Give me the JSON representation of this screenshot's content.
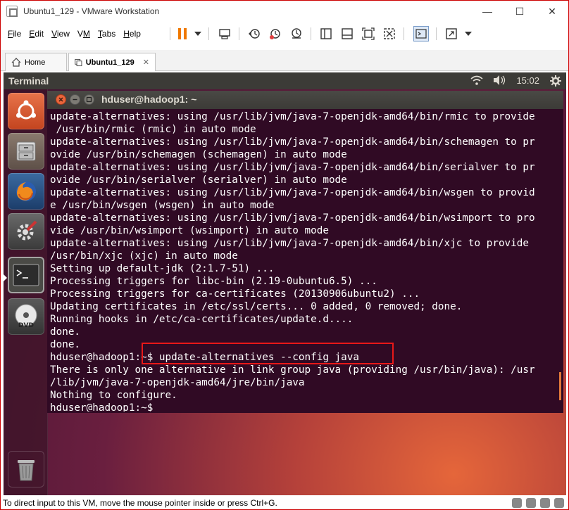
{
  "window": {
    "title": "Ubuntu1_129 - VMware Workstation",
    "controls": {
      "minimize": "—",
      "maximize": "☐",
      "close": "✕"
    }
  },
  "menu": {
    "items": [
      {
        "label": "File",
        "accel": "F"
      },
      {
        "label": "Edit",
        "accel": "E"
      },
      {
        "label": "View",
        "accel": "V"
      },
      {
        "label": "VM",
        "accel": "M"
      },
      {
        "label": "Tabs",
        "accel": "T"
      },
      {
        "label": "Help",
        "accel": "H"
      }
    ]
  },
  "toolbar": {
    "icons": [
      "pause-icon",
      "dropdown-icon",
      "send-ctrl-alt-del-icon",
      "snapshot-icon",
      "revert-snapshot-icon",
      "snapshot-manager-icon",
      "sidebar-icon",
      "thumbnail-icon",
      "fullscreen-icon",
      "unity-icon",
      "console-icon",
      "stretch-icon"
    ]
  },
  "tabs": [
    {
      "label": "Home",
      "icon": "home-icon"
    },
    {
      "label": "Ubuntu1_129",
      "icon": "vm-icon",
      "active": true
    }
  ],
  "guest_panel": {
    "app_name": "Terminal",
    "time": "15:02",
    "icons": [
      "wifi-icon",
      "volume-icon",
      "settings-icon"
    ]
  },
  "launcher": {
    "items": [
      {
        "name": "ubuntu-dash-icon"
      },
      {
        "name": "files-icon"
      },
      {
        "name": "firefox-icon"
      },
      {
        "name": "system-settings-icon"
      },
      {
        "name": "terminal-icon",
        "active": true
      },
      {
        "name": "dvd-icon"
      }
    ],
    "trash": "trash-icon"
  },
  "terminal": {
    "title": "hduser@hadoop1: ~",
    "lines": [
      "update-alternatives: using /usr/lib/jvm/java-7-openjdk-amd64/bin/rmic to provide",
      " /usr/bin/rmic (rmic) in auto mode",
      "update-alternatives: using /usr/lib/jvm/java-7-openjdk-amd64/bin/schemagen to pr",
      "ovide /usr/bin/schemagen (schemagen) in auto mode",
      "update-alternatives: using /usr/lib/jvm/java-7-openjdk-amd64/bin/serialver to pr",
      "ovide /usr/bin/serialver (serialver) in auto mode",
      "update-alternatives: using /usr/lib/jvm/java-7-openjdk-amd64/bin/wsgen to provid",
      "e /usr/bin/wsgen (wsgen) in auto mode",
      "update-alternatives: using /usr/lib/jvm/java-7-openjdk-amd64/bin/wsimport to pro",
      "vide /usr/bin/wsimport (wsimport) in auto mode",
      "update-alternatives: using /usr/lib/jvm/java-7-openjdk-amd64/bin/xjc to provide",
      "/usr/bin/xjc (xjc) in auto mode",
      "Setting up default-jdk (2:1.7-51) ...",
      "Processing triggers for libc-bin (2.19-0ubuntu6.5) ...",
      "Processing triggers for ca-certificates (20130906ubuntu2) ...",
      "Updating certificates in /etc/ssl/certs... 0 added, 0 removed; done.",
      "Running hooks in /etc/ca-certificates/update.d....",
      "done.",
      "done.",
      "hduser@hadoop1:~$ update-alternatives --config java",
      "There is only one alternative in link group java (providing /usr/bin/java): /usr",
      "/lib/jvm/java-7-openjdk-amd64/jre/bin/java",
      "Nothing to configure.",
      "hduser@hadoop1:~$"
    ]
  },
  "statusbar": {
    "text": "To direct input to this VM, move the mouse pointer inside or press Ctrl+G."
  },
  "colors": {
    "terminal_bg": "#300a24",
    "highlight": "#e81818",
    "window_border": "#cc0000"
  }
}
